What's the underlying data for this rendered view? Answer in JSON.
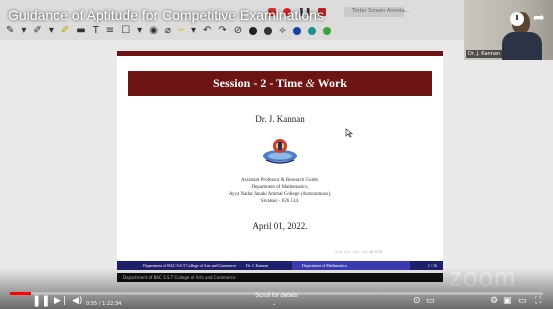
{
  "video": {
    "title": "Guidance of Aptitude for Competitive Examinations",
    "progress_fraction": 0.04,
    "time_text": "0:55 / 1:22:34",
    "scroll_hint": "Scroll for details"
  },
  "gallery": {
    "name": "Dr. J. Kannan"
  },
  "toolbar": {
    "recording_text": "Tinter Screen Annota..."
  },
  "slide": {
    "title_prefix": "Session - 2 - Time ",
    "title_amp": "&",
    "title_suffix": " Work",
    "author": "Dr. J. Kannan",
    "affil_line1": "Assistant Professor & Research Guide,",
    "affil_line2": "Department of Mathematics,",
    "affil_line3": "Ayya Nadar Janaki Ammal College (Autonomous),",
    "affil_line4": "Sivakasi - 626 124.",
    "date": "April 01, 2022.",
    "nav_symbols": "◁ ▷ ◁ ▷ ◁ ▷ ◁ ▷   ⇄ ⟲ ⟳",
    "footer_college": "Department of BAC S.S.T College of Arts and Commerce",
    "footer_author": "Dr. J. Kannan",
    "footer_dept": "Department of Mathematics",
    "footer_page": "1 / 16"
  },
  "strip_text": "Department of BAC S.S.T College of Arts and Commerce",
  "watermark": "zoom",
  "colors": {
    "title_bg": "#6d1414",
    "footer_bg": "#1f1f6b",
    "progress": "#ff0000"
  }
}
